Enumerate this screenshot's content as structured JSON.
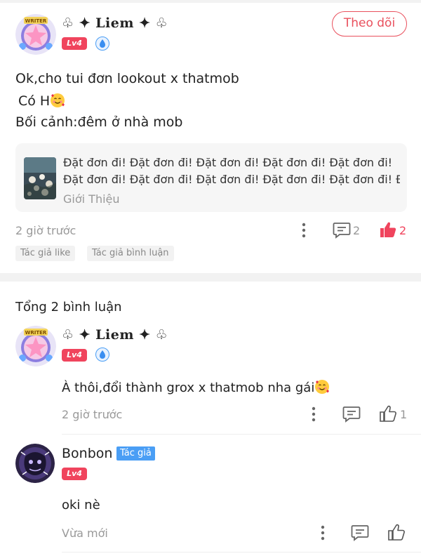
{
  "post": {
    "author": {
      "name": "♧ ✦ Liem ✦ ♧",
      "level": "Lv4",
      "avatar_icon": "writer-frame-avatar-icon",
      "verify_icon": "blue-water-drop-badge-icon"
    },
    "follow_label": "Theo dõi",
    "lines": [
      "Ok,cho tui đơn lookout x thatmob",
      " Có H",
      "Bối cảnh:đêm ở nhà mob"
    ],
    "emoji_icon": "smiling-face-with-hearts-emoji",
    "story_card": {
      "line1": "Đặt đơn đi! Đặt đơn đi! Đặt đơn đi! Đặt đơn đi! Đặt đơn đi!",
      "line2": "Đặt đơn đi! Đặt đơn đi! Đặt đơn đi! Đặt đơn đi! Đặt đơn đi! Đ...",
      "subtitle": "Giới Thiệu",
      "thumb_icon": "flowers-night-thumbnail"
    },
    "time": "2 giờ trước",
    "comment_count": "2",
    "like_count": "2",
    "tags": [
      "Tác giả like",
      "Tác giả bình luận"
    ]
  },
  "comments_header": "Tổng 2 bình luận",
  "comments": [
    {
      "name": "♧ ✦ Liem ✦ ♧",
      "level": "Lv4",
      "text": "À thôi,đổi thành grox x thatmob nha gái",
      "time": "2 giờ trước",
      "like_count": "1"
    },
    {
      "name": "Bonbon",
      "author_tag": "Tác giả",
      "level": "Lv4",
      "text": "oki nè",
      "time": "Vừa mới",
      "like_count": ""
    }
  ],
  "colors": {
    "accent": "#e9505d",
    "level_badge": "#f0445d",
    "author_tag": "#4a9ef5",
    "muted": "#999999"
  }
}
